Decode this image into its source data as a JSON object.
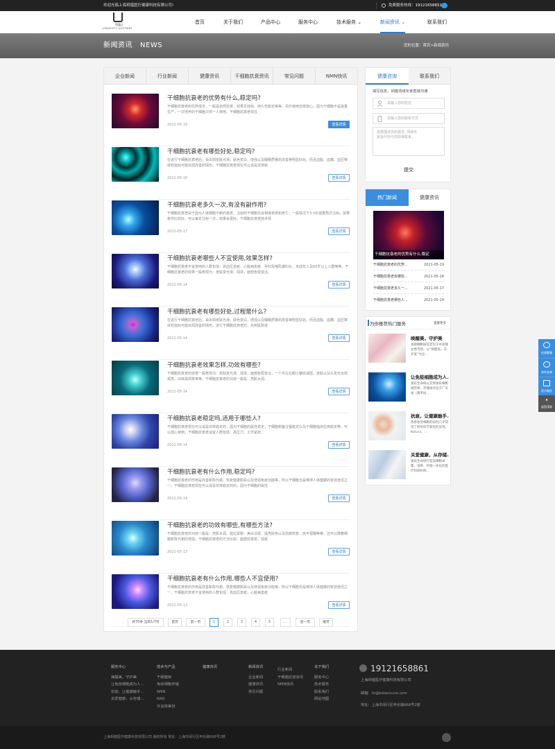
{
  "topbar": {
    "welcome": "欢迎光临上海玥蕴医疗健康科技有限公司!",
    "hotline_label": "免费服务热线：",
    "hotline": "19121658861"
  },
  "logo": {
    "cn": "玥蕴之",
    "en": "LONGEVITY QUOTIENT"
  },
  "nav": [
    "首页",
    "关于我们",
    "产品中心",
    "服务中心",
    "技术服务",
    "新闻资讯",
    "联系我们"
  ],
  "banner": {
    "title": "新闻资讯   NEWS",
    "breadcrumb": "您的位置：首页>新闻资讯"
  },
  "tabs": [
    "企业新闻",
    "行业新闻",
    "健康资讯",
    "干细胞抗衰资讯",
    "常见问题",
    "NMN快讯"
  ],
  "articles": [
    {
      "title": "干细胞抗衰老的优势有什么,稳定吗?",
      "desc": "干细胞抗衰老的优势很多，一般是自然抗衰，效果见效快、持久性稳定等等，另外使用非常放心。因为干细胞不是批量生产，一次培养的干细胞只供一人使用。干细胞抗衰老现在",
      "date": "2021-05-19",
      "more": "查看详情"
    },
    {
      "title": "干细胞抗衰老有哪些好处,稳定吗?",
      "desc": "在进行干细胞抗衰老后，会出现皮肤光滑，肤色变白，增强以及睡眠质量的改善等明显好处。而且血脂、血糖、血压等体检指标可能出现改善的情形。干细胞抗衰老现在可以说是非常稳",
      "date": "2021-05-18",
      "more": "查看详情"
    },
    {
      "title": "干细胞抗衰老多久一次,有没有副作用?",
      "desc": "干细胞抗衰老由于因为人体细胞不断的衰老，注射的干细胞也会相继衰老和死亡，一般情况下3-5年需要再次注射。如果条件比较好，可以每年注射一次，效果会更好。干细胞抗衰老技术现",
      "date": "2021-05-17",
      "more": "查看详情"
    },
    {
      "title": "干细胞抗衰老哪些人不宜使用,效果怎样?",
      "desc": "干细胞抗衰老不宜使用的人群包括：高血压患者、心脏病患者、孕妇及哺乳期妇女、未成年人及60岁以上人群等等。干细胞抗衰老的效果一般表现为：皮肤变光滑、润泽，面部色斑变淡。",
      "date": "2021-05-14",
      "more": "查看详情"
    },
    {
      "title": "干细胞抗衰老有哪些好处,过程是什么?",
      "desc": "在进行干细胞抗衰老后，会出现皮肤光滑，肤色变白，增强以及睡眠质量的改善等明显好处。而且血脂、血糖、血压等体检指标可能出现改善的情形。进行干细胞抗衰老时，先到医院进",
      "date": "2021-05-14",
      "more": "查看详情"
    },
    {
      "title": "干细胞抗衰老效果怎样,功效有哪些?",
      "desc": "干细胞抗衰老的效果一般表现为：皮肤变光滑、润泽，面部色斑变淡，一个月左右眼小皱纹减轻，皮肤以及头发可出现黑亮，白转黑现象等等。干细胞抗衰老的功效一般是：亮肌水润、",
      "date": "2021-05-14",
      "more": "查看详情"
    },
    {
      "title": "干细胞抗衰老稳定吗,适用于哪些人?",
      "desc": "干细胞抗衰老现在可以说是非常稳定的，因为干细胞的属性稳定，干细胞制备过程稳定以及干细胞临床应用稳定等，可以放心使用。干细胞抗衰老适宜人群包括：高压力、工作紧张、",
      "date": "2021-05-14",
      "more": "查看详情"
    },
    {
      "title": "干细胞抗衰老有什么作用,稳定吗?",
      "desc": "干细胞抗衰老的作用是改善新陈代谢，恢复健康肌肤以及增强免疫功能等，所以干细胞也是维持人体健康的有效途径之一。干细胞抗衰老现在可以说是非常稳定的的，因为干细胞的属性",
      "date": "2021-05-14",
      "more": "查看详情"
    },
    {
      "title": "干细胞抗衰老的功效有哪些,有哪些方法?",
      "desc": "干细胞抗衰老的功效一般是：亮肌水润、提拉紧致、美白淡斑、提亮肤色以及抗敏修复、抚平褶皱等等。还可以随着细胞新陈代谢的增强。干细胞抗衰老的方法比如：面部抗衰老、祛斑",
      "date": "2021-05-13",
      "more": "查看详情"
    },
    {
      "title": "干细胞抗衰老有什么作用,哪些人不宜使用?",
      "desc": "干细胞抗衰老的作用是改善新陈代谢，恢复健康肌肤以及增强免疫功能等，所以干细胞也是维持人体健康的有效途径之一。干细胞抗衰老不宜使用的人群包括：高血压患者、心脏病患者",
      "date": "2021-05-13",
      "more": "查看详情"
    }
  ],
  "pager": {
    "info": "共70条 当前1/7页",
    "first": "首页",
    "prev": "前一页",
    "pages": [
      "1",
      "2",
      "3",
      "4",
      "5"
    ],
    "ellipsis": "...",
    "next": "后一页",
    "last": "尾页"
  },
  "consult": {
    "tab_active": "健康咨询",
    "tab_other": "联系我们",
    "hint": "填写信息，玥蕴领域专家直接沟通",
    "name_placeholder": "请输入您的姓名",
    "phone_placeholder": "请输入您的联系方式",
    "msg_placeholder": "需要描述您的需求, 领域专家会尽快与您取得联系。",
    "submit": "提交"
  },
  "hot": {
    "tab_active": "热门新闻",
    "tab_other": "健康资讯",
    "caption": "干细胞抗衰老的优势有什么,稳定",
    "list": [
      {
        "name": "干细胞抗衰老的优势...",
        "date": "2021-05-19"
      },
      {
        "name": "干细胞抗衰老有哪些...",
        "date": "2021-05-18"
      },
      {
        "name": "干细胞抗衰老多久一...",
        "date": "2021-05-17"
      },
      {
        "name": "干细胞抗衰老哪些人...",
        "date": "2021-05-14"
      }
    ]
  },
  "services": {
    "title": "为你推荐热门服务",
    "more": "查看更多",
    "items": [
      {
        "title": "唤醒美，守护美",
        "desc": "逐那细胞研任定位于中高端女性市场，以“唤醒美，守护美”为企…"
      },
      {
        "title": "让免疫细胞成为人…",
        "desc": "速玖生命研以又称速玖细胞储存库，存储地点位于广东省（嘉禾拉…"
      },
      {
        "title": "抗衰，让健康触手…",
        "desc": "改善衰老细胞的研究几乎得到了所有科学家的的支持。Nature、…"
      },
      {
        "title": "关爱健康，从存储…",
        "desc": "速玖生命研行是美细胞采集、培养、存储一体化的医疗科研机构…"
      }
    ]
  },
  "float": [
    "在线客服",
    "合作咨询",
    "官方微信",
    "返回顶部"
  ],
  "footer": {
    "cols": [
      {
        "head": "服务中心",
        "items": [
          "唤醒美，守护美",
          "让免疫细胞成为人…",
          "抗衰，让健康触手…",
          "关爱健康，从存储…"
        ]
      },
      {
        "head": "技术与产品",
        "items": [
          "干细胞库",
          "免疫细胞存储",
          "NMN",
          "NAD",
          "外泌体美容"
        ]
      },
      {
        "head": "健康资讯",
        "items": []
      },
      {
        "head": "新闻资讯",
        "items": [
          "企业新闻",
          "健康资讯",
          "常见问题"
        ]
      },
      {
        "head": "",
        "items": [
          "行业新闻",
          "干细胞抗衰资讯",
          "NMN快讯"
        ]
      },
      {
        "head": "关于我们",
        "items": [
          "服务中心",
          "技术服务",
          "联系我们",
          "网站地图"
        ]
      }
    ],
    "phone": "19121658861",
    "company": "上海玥蕴医疗健康科技有限公司",
    "email": "邮箱：hr@botanicure.com",
    "address": "地址：上海市闵行区申长路668号2楼"
  },
  "copyright": "上海玥蕴医疗健康科技有限公司 版权所有  地址：上海市闵行区申长路668号2楼",
  "colors": {
    "accent": "#2a7bd1",
    "button": "#3a8ee0",
    "footer": "#222222"
  }
}
